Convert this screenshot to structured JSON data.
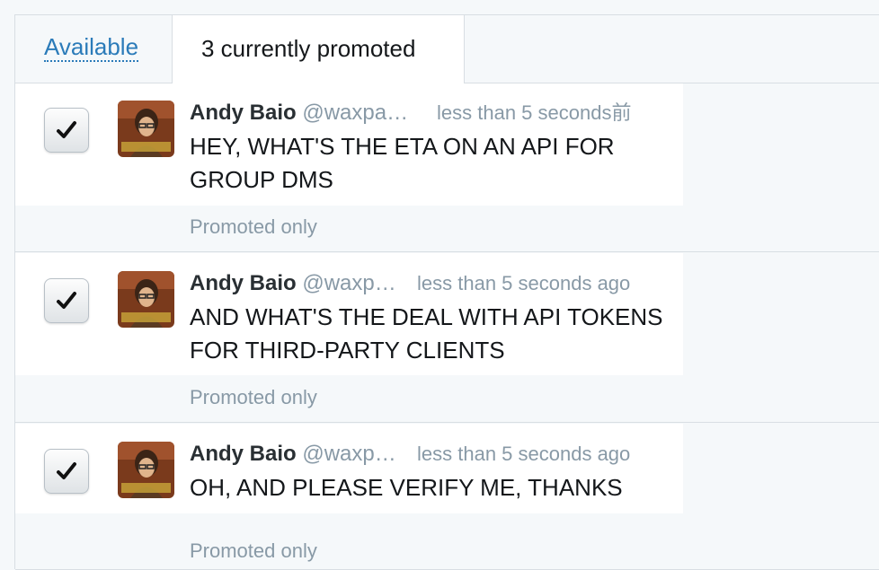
{
  "tabs": {
    "available_label": "Available",
    "promoted_label": "3 currently promoted"
  },
  "tweets": [
    {
      "checked": true,
      "author_name": "Andy Baio",
      "handle": "@waxpa…",
      "timestamp": "less than 5 seconds前",
      "text": "HEY, WHAT'S THE ETA ON AN API FOR GROUP DMS",
      "promoted_label": "Promoted only"
    },
    {
      "checked": true,
      "author_name": "Andy Baio",
      "handle": "@waxp…",
      "timestamp": "less than 5 seconds ago",
      "text": "AND WHAT'S THE DEAL WITH API TOKENS FOR THIRD-PARTY CLIENTS",
      "promoted_label": "Promoted only"
    },
    {
      "checked": true,
      "author_name": "Andy Baio",
      "handle": "@waxp…",
      "timestamp": "less than 5 seconds ago",
      "text": "OH, AND PLEASE VERIFY ME, THANKS",
      "promoted_label": "Promoted only"
    }
  ],
  "icons": {
    "checkbox": "checkmark-icon",
    "avatar": "user-avatar"
  },
  "colors": {
    "link": "#2b7bb9",
    "muted": "#8899a6",
    "text": "#14171a",
    "background": "#f5f8fa",
    "border": "#d8dee3"
  }
}
